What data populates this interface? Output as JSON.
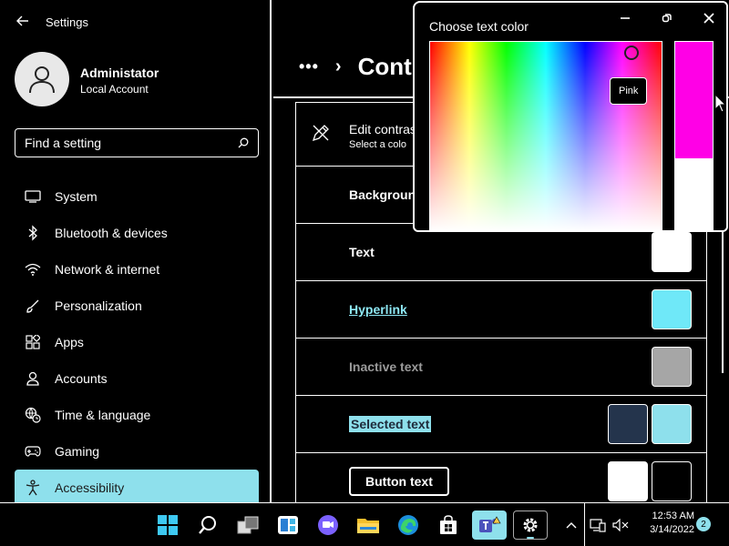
{
  "app": {
    "title": "Settings"
  },
  "user": {
    "name": "Administator",
    "type": "Local Account"
  },
  "search": {
    "placeholder": "Find a setting"
  },
  "nav": [
    {
      "label": "System",
      "icon": "monitor-icon"
    },
    {
      "label": "Bluetooth & devices",
      "icon": "bluetooth-icon"
    },
    {
      "label": "Network & internet",
      "icon": "wifi-icon"
    },
    {
      "label": "Personalization",
      "icon": "brush-icon"
    },
    {
      "label": "Apps",
      "icon": "apps-icon"
    },
    {
      "label": "Accounts",
      "icon": "person-icon"
    },
    {
      "label": "Time & language",
      "icon": "globe-clock-icon"
    },
    {
      "label": "Gaming",
      "icon": "gamepad-icon"
    },
    {
      "label": "Accessibility",
      "icon": "accessibility-icon",
      "active": true
    }
  ],
  "breadcrumb": {
    "more": "•••",
    "separator": "›",
    "current": "Cont"
  },
  "rows": {
    "edit": {
      "title": "Edit contras",
      "desc": "Select a colo"
    },
    "background": {
      "label": "Backgroun"
    },
    "text": {
      "label": "Text",
      "color": "#ffffff"
    },
    "hyperlink": {
      "label": "Hyperlink",
      "color": "#6fe8f8"
    },
    "inactive": {
      "label": "Inactive text",
      "color": "#a6a6a6"
    },
    "selected": {
      "label": "Selected text",
      "color_bg": "#24344c",
      "color_fg": "#8ee0ec"
    },
    "button": {
      "label": "Button text",
      "color_bg": "#ffffff",
      "color_fg": "#000000"
    }
  },
  "picker": {
    "title": "Choose text color",
    "tooltip": "Pink",
    "selected_color": "#ff00e6"
  },
  "taskbar": {
    "time": "12:53 AM",
    "date": "3/14/2022",
    "notifications": "2"
  }
}
